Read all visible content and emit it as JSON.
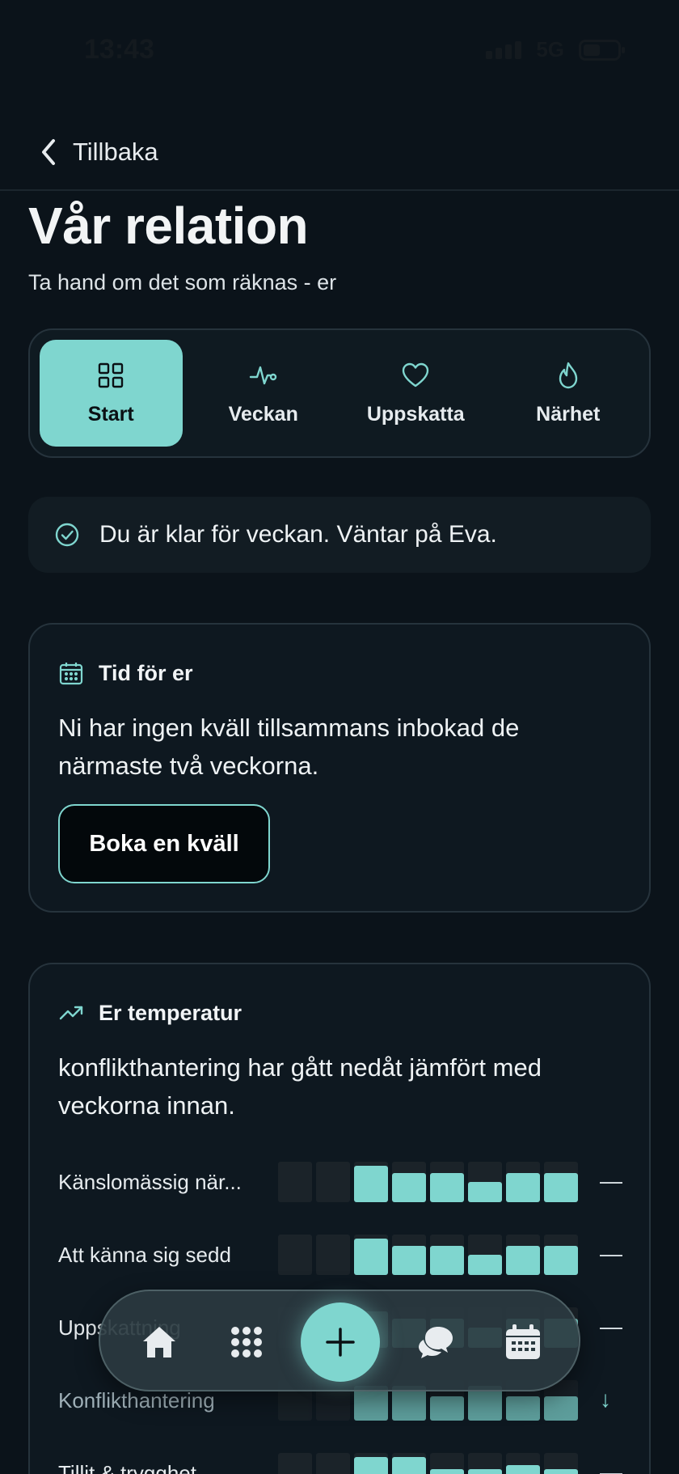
{
  "status": {
    "time": "13:43",
    "network": "5G"
  },
  "nav": {
    "back_label": "Tillbaka"
  },
  "header": {
    "title": "Vår relation",
    "subtitle": "Ta hand om det som räknas - er"
  },
  "tabs": [
    {
      "label": "Start",
      "icon": "grid-icon",
      "active": true
    },
    {
      "label": "Veckan",
      "icon": "pulse-icon",
      "active": false
    },
    {
      "label": "Uppskatta",
      "icon": "heart-icon",
      "active": false
    },
    {
      "label": "Närhet",
      "icon": "flame-icon",
      "active": false
    }
  ],
  "notice": {
    "text": "Du är klar för veckan. Väntar på Eva.",
    "icon": "check-circle-icon"
  },
  "time_card": {
    "title": "Tid för er",
    "icon": "calendar-icon",
    "body": "Ni har ingen kväll tillsammans inbokad de närmaste två veckorna.",
    "button_label": "Boka en kväll"
  },
  "temp_card": {
    "title": "Er temperatur",
    "icon": "trend-up-icon",
    "body": "konflikthantering har gått nedåt jämfört med veckorna innan.",
    "metrics": [
      {
        "label": "Känslomässig när...",
        "levels": [
          0,
          0,
          0.9,
          0.72,
          0.72,
          0.5,
          0.72,
          0.72
        ],
        "trend": "—"
      },
      {
        "label": "Att känna sig sedd",
        "levels": [
          0,
          0,
          0.9,
          0.72,
          0.72,
          0.5,
          0.72,
          0.72
        ],
        "trend": "—"
      },
      {
        "label": "Uppskattning",
        "levels": [
          0,
          0,
          0.9,
          0.72,
          0.72,
          0.5,
          0.72,
          0.72
        ],
        "trend": "—"
      },
      {
        "label": "Konflikthantering",
        "levels": [
          0,
          0,
          0.85,
          0.85,
          0.6,
          0.85,
          0.6,
          0.6
        ],
        "trend": "↓"
      },
      {
        "label": "Tillit & trygghet",
        "levels": [
          0,
          0,
          0.9,
          0.9,
          0.6,
          0.6,
          0.7,
          0.6
        ],
        "trend": "—"
      }
    ]
  },
  "bottom_nav": {
    "items": [
      "home-icon",
      "apps-grid-icon",
      "plus-icon",
      "chat-bubbles-icon",
      "calendar-icon"
    ]
  },
  "colors": {
    "accent": "#7fd6cf",
    "background": "#0b131a",
    "card": "#0e1820"
  }
}
